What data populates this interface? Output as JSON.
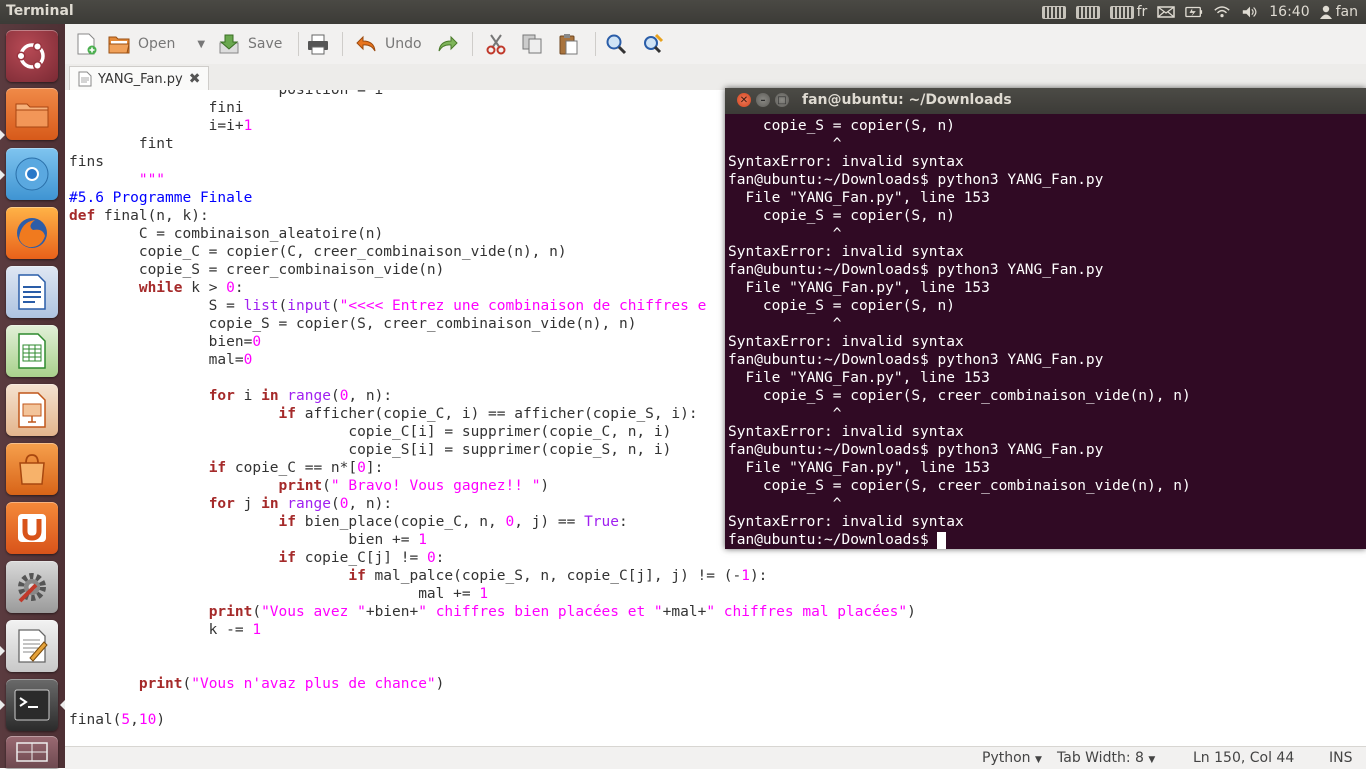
{
  "panel": {
    "app_title": "Terminal",
    "keyboard_layout": "fr",
    "clock": "16:40",
    "user": "fan"
  },
  "launcher": {
    "items": [
      {
        "name": "Dash"
      },
      {
        "name": "Files"
      },
      {
        "name": "Chromium"
      },
      {
        "name": "Firefox"
      },
      {
        "name": "LibreOffice Writer"
      },
      {
        "name": "LibreOffice Calc"
      },
      {
        "name": "LibreOffice Impress"
      },
      {
        "name": "Ubuntu Software Center"
      },
      {
        "name": "Ubuntu One"
      },
      {
        "name": "System Settings"
      },
      {
        "name": "Text Editor"
      },
      {
        "name": "Terminal"
      },
      {
        "name": "Workspace Switcher"
      }
    ]
  },
  "toolbar": {
    "open_label": "Open",
    "save_label": "Save",
    "undo_label": "Undo"
  },
  "tab": {
    "filename": "YANG_Fan.py",
    "close_glyph": "✖"
  },
  "code_lines": [
    "                        position = i",
    "                fini",
    "                i=i+1",
    "        fint",
    "fins",
    "        \"\"\"",
    "#5.6 Programme Finale",
    "def final(n, k):",
    "        C = combinaison_aleatoire(n)",
    "        copie_C = copier(C, creer_combinaison_vide(n), n)",
    "        copie_S = creer_combinaison_vide(n)",
    "        while k > 0:",
    "                S = list(input(\"<<<< Entrez une combinaison de chiffres e",
    "                copie_S = copier(S, creer_combinaison_vide(n), n)",
    "                bien=0",
    "                mal=0",
    "",
    "                for i in range(0, n):",
    "                        if afficher(copie_C, i) == afficher(copie_S, i):",
    "                                copie_C[i] = supprimer(copie_C, n, i)",
    "                                copie_S[i] = supprimer(copie_S, n, i)",
    "                if copie_C == n*[0]:",
    "                        print(\" Bravo! Vous gagnez!! \")",
    "                for j in range(0, n):",
    "                        if bien_place(copie_C, n, 0, j) == True:",
    "                                bien += 1",
    "                        if copie_C[j] != 0:",
    "                                if mal_palce(copie_S, n, copie_C[j], j) != (-1):",
    "                                        mal += 1",
    "                print(\"Vous avez \"+bien+\" chiffres bien placées et \"+mal+\" chiffres mal placées\")",
    "                k -= 1",
    "",
    "",
    "        print(\"Vous n'avaz plus de chance\")",
    "",
    "final(5,10)"
  ],
  "statusbar": {
    "language": "Python",
    "tab_width": "Tab Width: 8",
    "position": "Ln 150, Col 44",
    "mode": "INS"
  },
  "terminal": {
    "title": "fan@ubuntu: ~/Downloads",
    "lines": [
      "    copie_S = copier(S, n)",
      "            ^",
      "SyntaxError: invalid syntax",
      "fan@ubuntu:~/Downloads$ python3 YANG_Fan.py",
      "  File \"YANG_Fan.py\", line 153",
      "    copie_S = copier(S, n)",
      "            ^",
      "SyntaxError: invalid syntax",
      "fan@ubuntu:~/Downloads$ python3 YANG_Fan.py",
      "  File \"YANG_Fan.py\", line 153",
      "    copie_S = copier(S, n)",
      "            ^",
      "SyntaxError: invalid syntax",
      "fan@ubuntu:~/Downloads$ python3 YANG_Fan.py",
      "  File \"YANG_Fan.py\", line 153",
      "    copie_S = copier(S, creer_combinaison_vide(n), n)",
      "            ^",
      "SyntaxError: invalid syntax",
      "fan@ubuntu:~/Downloads$ python3 YANG_Fan.py",
      "  File \"YANG_Fan.py\", line 153",
      "    copie_S = copier(S, creer_combinaison_vide(n), n)",
      "            ^",
      "SyntaxError: invalid syntax",
      "fan@ubuntu:~/Downloads$ "
    ]
  },
  "colors": {
    "terminal_bg": "#300a24",
    "panel_bg": "#3c3b37",
    "launcher_bg": "#4e3034",
    "keyword": "#a52a2a",
    "string": "#ff00ff",
    "comment": "#0000ff",
    "builtin": "#a020f0"
  }
}
